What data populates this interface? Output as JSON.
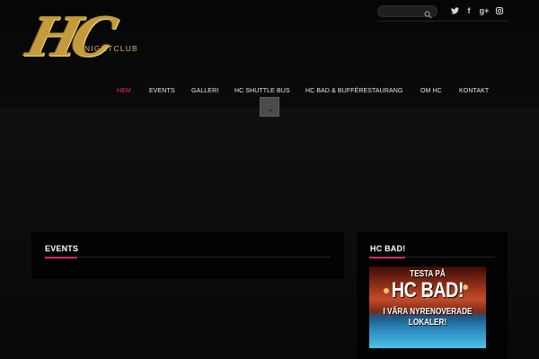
{
  "header": {
    "logo": {
      "letters": "HC",
      "word": "NIGHTCLUB"
    },
    "search": {
      "placeholder": "",
      "icon": "search-icon"
    },
    "social": [
      {
        "name": "twitter-icon"
      },
      {
        "name": "facebook-icon",
        "glyph": "f"
      },
      {
        "name": "google-plus-icon",
        "glyph": "g+"
      },
      {
        "name": "instagram-icon"
      }
    ]
  },
  "nav": {
    "items": [
      {
        "label": "HEM",
        "active": true
      },
      {
        "label": "EVENTS",
        "active": false
      },
      {
        "label": "GALLERI",
        "active": false
      },
      {
        "label": "HC SHUTTLE BUS",
        "active": false
      },
      {
        "label": "HC BAD & BUFFÉRESTAURANG",
        "active": false
      },
      {
        "label": "OM HC",
        "active": false
      },
      {
        "label": "KONTAKT",
        "active": false
      }
    ]
  },
  "sections": {
    "events": {
      "title": "EVENTS"
    },
    "hc_bad": {
      "title": "HC BAD!",
      "promo": {
        "line1": "TESTA PÅ",
        "line2": "HC BAD!",
        "line3": "I VÅRA NYRENOVERADE",
        "line4": "LOKALER!"
      }
    }
  },
  "colors": {
    "accent": "#e3246a",
    "background": "#070707",
    "panel": "#020202",
    "logo_gold": "#c49a3a"
  }
}
